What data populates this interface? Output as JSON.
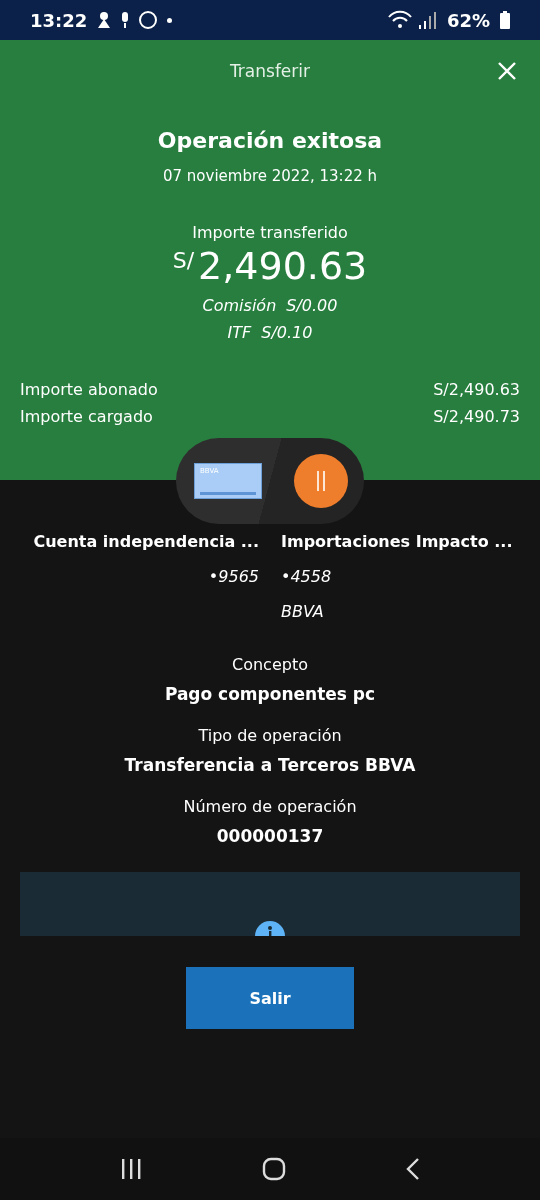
{
  "status_bar": {
    "time": "13:22",
    "battery": "62%"
  },
  "header": {
    "title": "Transferir"
  },
  "result": {
    "title": "Operación exitosa",
    "date": "07 noviembre 2022, 13:22 h",
    "amount_label": "Importe transferido",
    "currency": "S/",
    "amount": "2,490.63"
  },
  "fees": [
    {
      "label": "Comisión",
      "value": "S/0.00"
    },
    {
      "label": "ITF",
      "value": "S/0.10"
    }
  ],
  "totals": [
    {
      "label": "Importe abonado",
      "value": "S/2,490.63"
    },
    {
      "label": "Importe cargado",
      "value": "S/2,490.73"
    }
  ],
  "card_label": "BBVA",
  "origin": {
    "name": "Cuenta independencia ...",
    "account": "•9565"
  },
  "destination": {
    "name": "Importaciones Impacto ...",
    "account": "•4558",
    "bank": "BBVA"
  },
  "details": [
    {
      "label": "Concepto",
      "value": "Pago componentes pc"
    },
    {
      "label": "Tipo de operación",
      "value": "Transferencia a Terceros BBVA"
    },
    {
      "label": "Número de operación",
      "value": "000000137"
    }
  ],
  "button": "Salir"
}
